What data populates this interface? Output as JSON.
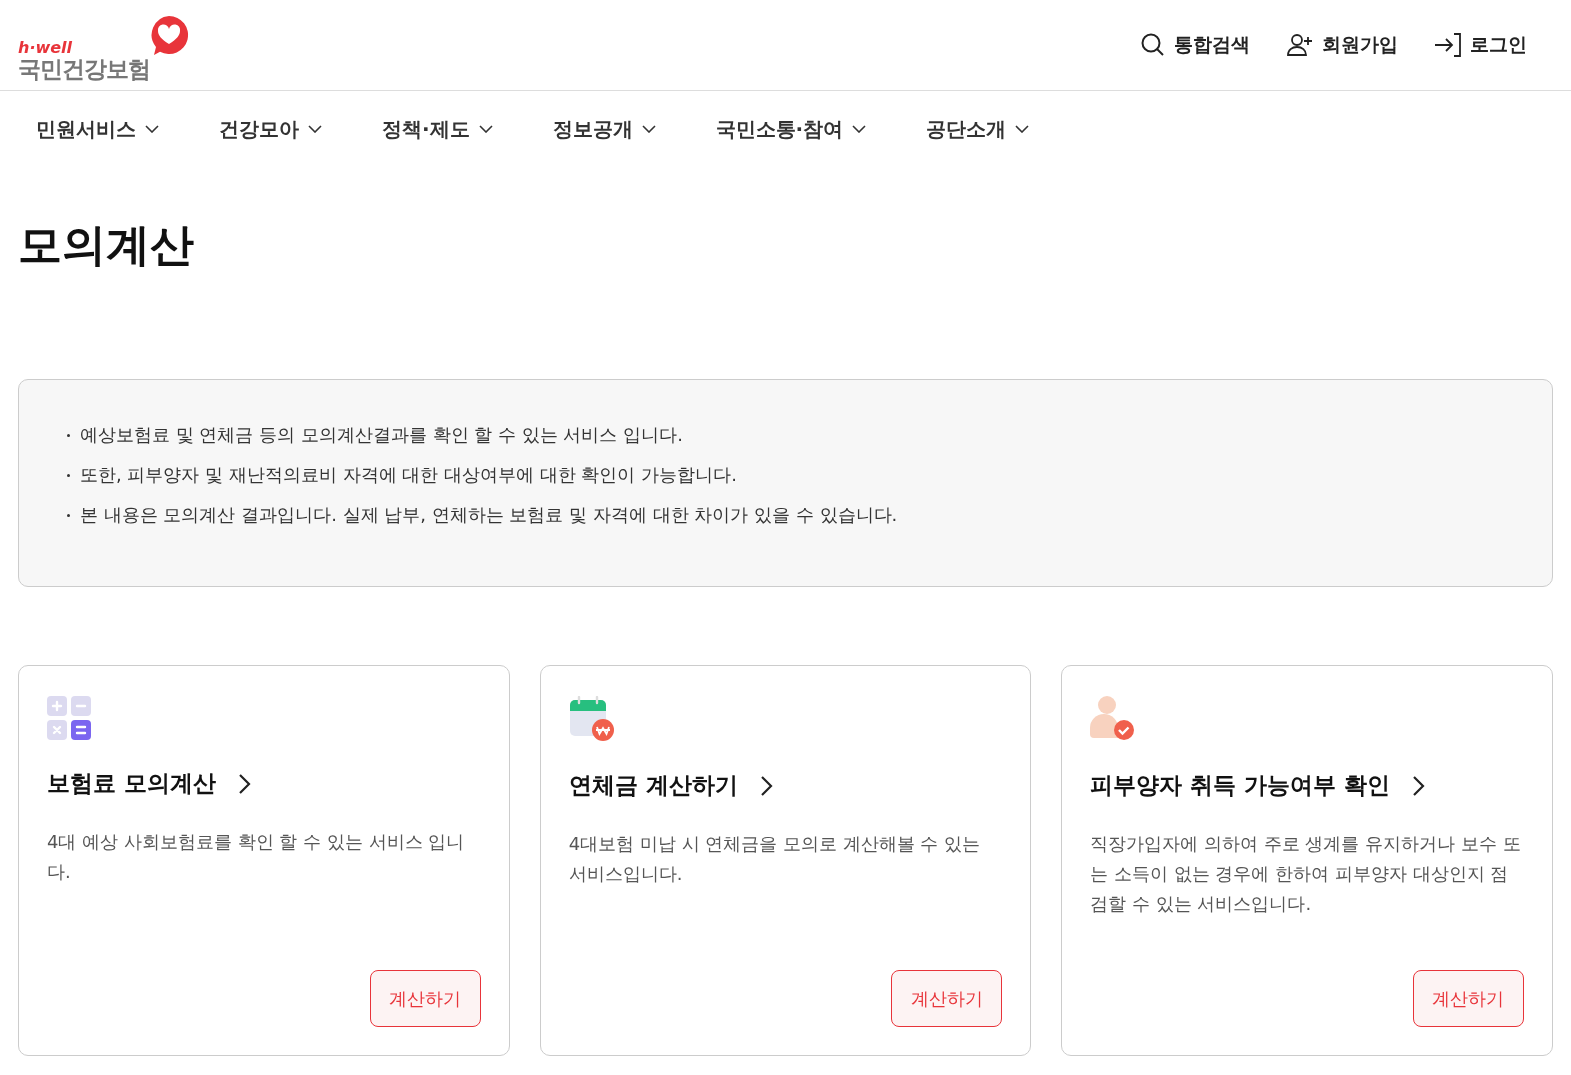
{
  "logo": {
    "tagline": "h·well",
    "name": "국민건강보험"
  },
  "utility_links": [
    {
      "kind": "search",
      "label": "통합검색"
    },
    {
      "kind": "join",
      "label": "회원가입"
    },
    {
      "kind": "login",
      "label": "로그인"
    }
  ],
  "nav": [
    "민원서비스",
    "건강모아",
    "정책·제도",
    "정보공개",
    "국민소통·참여",
    "공단소개"
  ],
  "page_title": "모의계산",
  "notices": [
    "예상보험료 및 연체금 등의 모의계산결과를 확인 할 수 있는 서비스 입니다.",
    "또한, 피부양자 및 재난적의료비 자격에 대한 대상여부에 대한 확인이 가능합니다.",
    "본 내용은 모의계산 결과입니다. 실제 납부, 연체하는 보험료 및 자격에 대한 차이가 있을 수 있습니다."
  ],
  "cards": [
    {
      "kind": "calculator",
      "title": "보험료 모의계산",
      "description": "4대 예상 사회보험료를 확인 할 수 있는 서비스 입니다.",
      "button": "계산하기"
    },
    {
      "kind": "calendar",
      "title": "연체금 계산하기",
      "description": "4대보험 미납 시 연체금을 모의로 계산해볼 수 있는 서비스입니다.",
      "button": "계산하기"
    },
    {
      "kind": "person",
      "title": "피부양자 취득 가능여부 확인",
      "description": "직장가입자에 의하여 주로 생계를 유지하거나 보수 또는 소득이 없는 경우에 한하여 피부양자 대상인지 점검할 수 있는 서비스입니다.",
      "button": "계산하기"
    }
  ]
}
